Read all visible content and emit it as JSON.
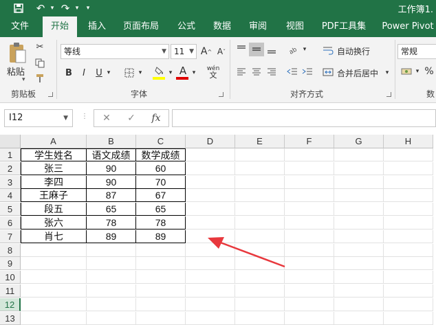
{
  "title": "工作簿1.",
  "tabs": [
    {
      "label": "文件"
    },
    {
      "label": "开始"
    },
    {
      "label": "插入"
    },
    {
      "label": "页面布局"
    },
    {
      "label": "公式"
    },
    {
      "label": "数据"
    },
    {
      "label": "审阅"
    },
    {
      "label": "视图"
    },
    {
      "label": "PDF工具集"
    },
    {
      "label": "Power Pivot"
    }
  ],
  "active_tab": "开始",
  "ribbon": {
    "clipboard": {
      "paste_label": "粘贴",
      "group_label": "剪贴板"
    },
    "font": {
      "family": "等线",
      "size": "11",
      "group_label": "字体",
      "bold": "B",
      "italic": "I",
      "underline": "U",
      "grow": "A",
      "shrink": "A",
      "phonetic": "wén"
    },
    "alignment": {
      "wrap_text": "自动换行",
      "merge_center": "合并后居中",
      "group_label": "对齐方式"
    },
    "number": {
      "format": "常规",
      "percent": "%",
      "group_label": "数"
    },
    "colors": {
      "fill": "#ffff00",
      "font": "#e00000",
      "accent": "#217346"
    }
  },
  "formula_bar": {
    "name_box": "I12",
    "cancel": "✕",
    "enter": "✓",
    "fx": "fx",
    "content": ""
  },
  "columns": [
    "A",
    "B",
    "C",
    "D",
    "E",
    "F",
    "G",
    "H"
  ],
  "rows": [
    "1",
    "2",
    "3",
    "4",
    "5",
    "6",
    "7",
    "8",
    "9",
    "10",
    "11",
    "12",
    "13"
  ],
  "selected_row": "12",
  "table": {
    "header": [
      "学生姓名",
      "语文成绩",
      "数学成绩"
    ],
    "data": [
      [
        "张三",
        "90",
        "60"
      ],
      [
        "李四",
        "90",
        "70"
      ],
      [
        "王麻子",
        "87",
        "67"
      ],
      [
        "段五",
        "65",
        "65"
      ],
      [
        "张六",
        "78",
        "78"
      ],
      [
        "肖七",
        "89",
        "89"
      ]
    ]
  },
  "annotation": {
    "arrow_color": "#e8383d"
  }
}
